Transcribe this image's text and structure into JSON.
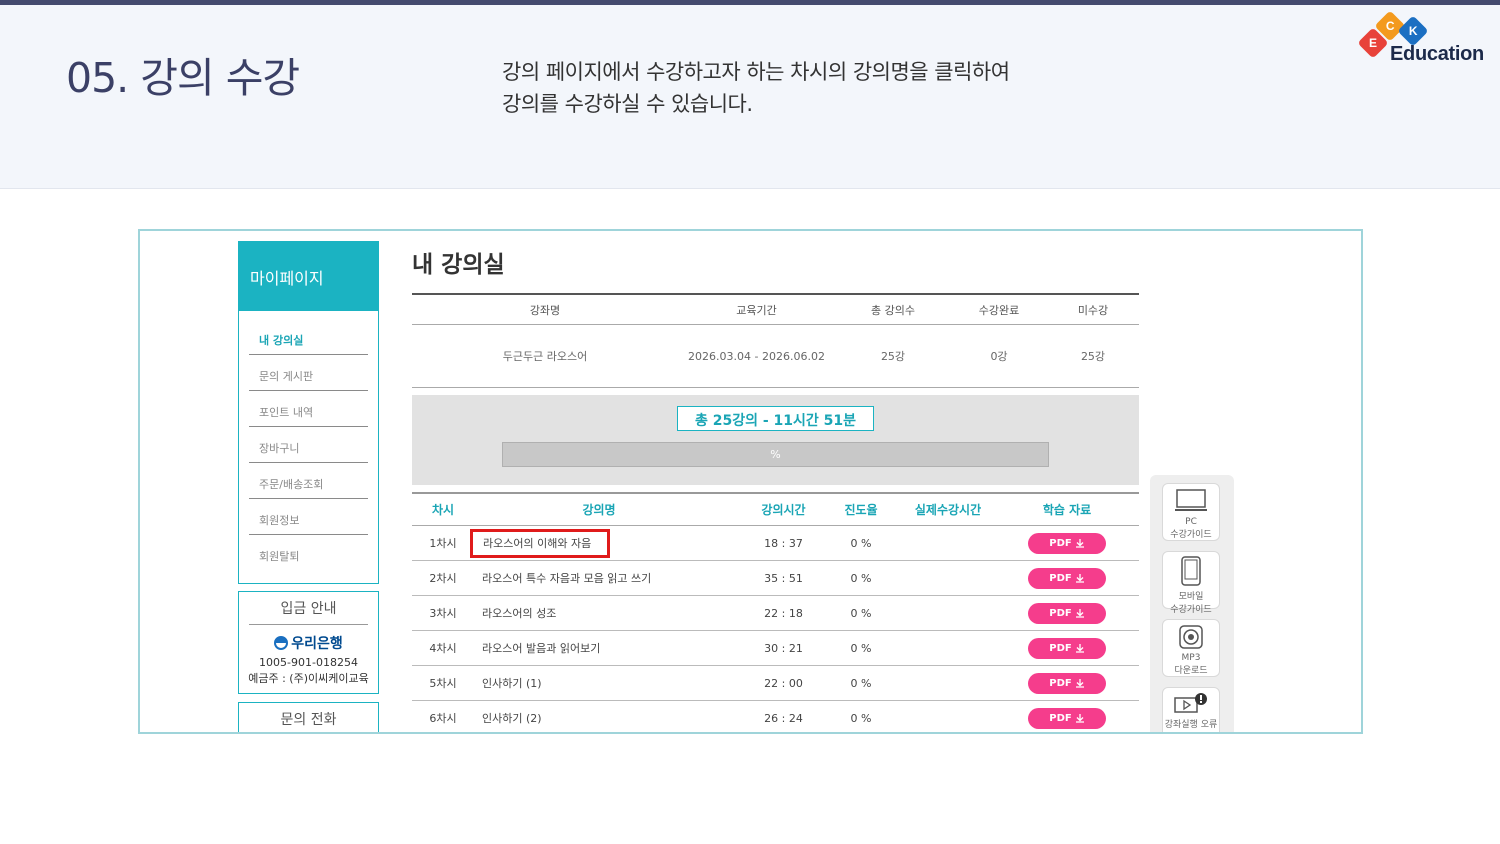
{
  "slide": {
    "title": "05. 강의 수강",
    "desc_line1": "강의 페이지에서 수강하고자 하는 차시의 강의명을 클릭하여",
    "desc_line2": "강의를 수강하실 수 있습니다."
  },
  "logo": {
    "letters": [
      "E",
      "C",
      "K"
    ],
    "text": "Education",
    "colors": {
      "E": "#e8423a",
      "C": "#f39a1e",
      "K": "#1b6fc2"
    }
  },
  "sidebar": {
    "header": "마이페이지",
    "items": [
      {
        "label": "내 강의실",
        "active": true
      },
      {
        "label": "문의 게시판",
        "active": false
      },
      {
        "label": "포인트 내역",
        "active": false
      },
      {
        "label": "장바구니",
        "active": false
      },
      {
        "label": "주문/배송조회",
        "active": false
      },
      {
        "label": "회원정보",
        "active": false
      },
      {
        "label": "회원탈퇴",
        "active": false
      }
    ],
    "bank": {
      "title": "입금 안내",
      "name": "우리은행",
      "account": "1005-901-018254",
      "owner": "예금주 : (주)이씨케이교육"
    },
    "call_title": "문의 전화"
  },
  "main": {
    "title": "내 강의실",
    "summary_headers": [
      "강좌명",
      "교육기간",
      "총 강의수",
      "수강완료",
      "미수강"
    ],
    "summary_row": [
      "두근두근 라오스어",
      "2026.03.04 - 2026.06.02",
      "25강",
      "0강",
      "25강"
    ],
    "progress_label": "총 25강의 - 11시간 51분",
    "progress_text": "%",
    "progress_value": 0,
    "lecture_headers": [
      "차시",
      "강의명",
      "강의시간",
      "진도율",
      "실제수강시간",
      "학습 자료"
    ],
    "pdf_label": "PDF",
    "lectures": [
      {
        "no": "1차시",
        "title": "라오스어의 이해와 자음",
        "time": "18 : 37",
        "rate": "0 %"
      },
      {
        "no": "2차시",
        "title": "라오스어 특수 자음과 모음 읽고 쓰기",
        "time": "35 : 51",
        "rate": "0 %"
      },
      {
        "no": "3차시",
        "title": "라오스어의 성조",
        "time": "22 : 18",
        "rate": "0 %"
      },
      {
        "no": "4차시",
        "title": "라오스어 발음과 읽어보기",
        "time": "30 : 21",
        "rate": "0 %"
      },
      {
        "no": "5차시",
        "title": "인사하기 (1)",
        "time": "22 : 00",
        "rate": "0 %"
      },
      {
        "no": "6차시",
        "title": "인사하기 (2)",
        "time": "26 : 24",
        "rate": "0 %"
      }
    ]
  },
  "quick_menu": {
    "pc_l1": "PC",
    "pc_l2": "수강가이드",
    "mobile_l1": "모바일",
    "mobile_l2": "수강가이드",
    "mp3_l1": "MP3",
    "mp3_l2": "다운로드",
    "error": "강좌실행 오류"
  }
}
